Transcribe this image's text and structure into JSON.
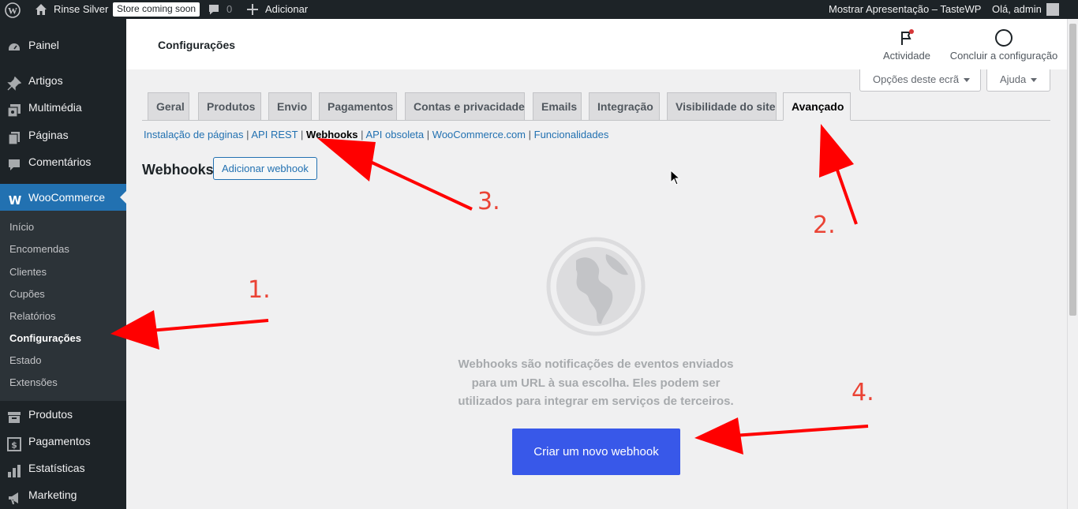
{
  "adminbar": {
    "site_name": "Rinse Silver",
    "store_badge": "Store coming soon",
    "comments_count": "0",
    "add_new": "Adicionar",
    "presentation": "Mostrar Apresentação – TasteWP",
    "greeting": "Olá, admin"
  },
  "sidebar": {
    "items": [
      {
        "label": "Painel",
        "icon": "dashboard-icon"
      },
      {
        "label": "Artigos",
        "icon": "pin-icon"
      },
      {
        "label": "Multimédia",
        "icon": "media-icon"
      },
      {
        "label": "Páginas",
        "icon": "pages-icon"
      },
      {
        "label": "Comentários",
        "icon": "comment-icon"
      },
      {
        "label": "WooCommerce",
        "icon": "woocommerce-icon"
      },
      {
        "label": "Produtos",
        "icon": "archive-icon"
      },
      {
        "label": "Pagamentos",
        "icon": "money-icon"
      },
      {
        "label": "Estatísticas",
        "icon": "chart-icon"
      },
      {
        "label": "Marketing",
        "icon": "megaphone-icon"
      }
    ],
    "submenu": [
      "Início",
      "Encomendas",
      "Clientes",
      "Cupões",
      "Relatórios",
      "Configurações",
      "Estado",
      "Extensões"
    ]
  },
  "header": {
    "title": "Configurações",
    "activity": "Actividade",
    "finish_setup": "Concluir a configuração"
  },
  "screen_options": {
    "options": "Opções deste ecrã",
    "help": "Ajuda"
  },
  "tabs": [
    "Geral",
    "Produtos",
    "Envio",
    "Pagamentos",
    "Contas e privacidade",
    "Emails",
    "Integração",
    "Visibilidade do site",
    "Avançado"
  ],
  "sublinks": [
    "Instalação de páginas",
    "API REST",
    "Webhooks",
    "API obsoleta",
    "WooCommerce.com",
    "Funcionalidades"
  ],
  "main": {
    "section_title": "Webhooks",
    "add_button": "Adicionar webhook",
    "empty_text": "Webhooks são notificações de eventos enviados para um URL à sua escolha. Eles podem ser utilizados para integrar em serviços de terceiros.",
    "create_button": "Criar um novo webhook"
  },
  "annotations": [
    "1.",
    "2.",
    "3.",
    "4."
  ],
  "colors": {
    "sidebar": "#1d2327",
    "accent": "#2271b1",
    "button": "#3858e9",
    "annotation": "#ea4335"
  }
}
